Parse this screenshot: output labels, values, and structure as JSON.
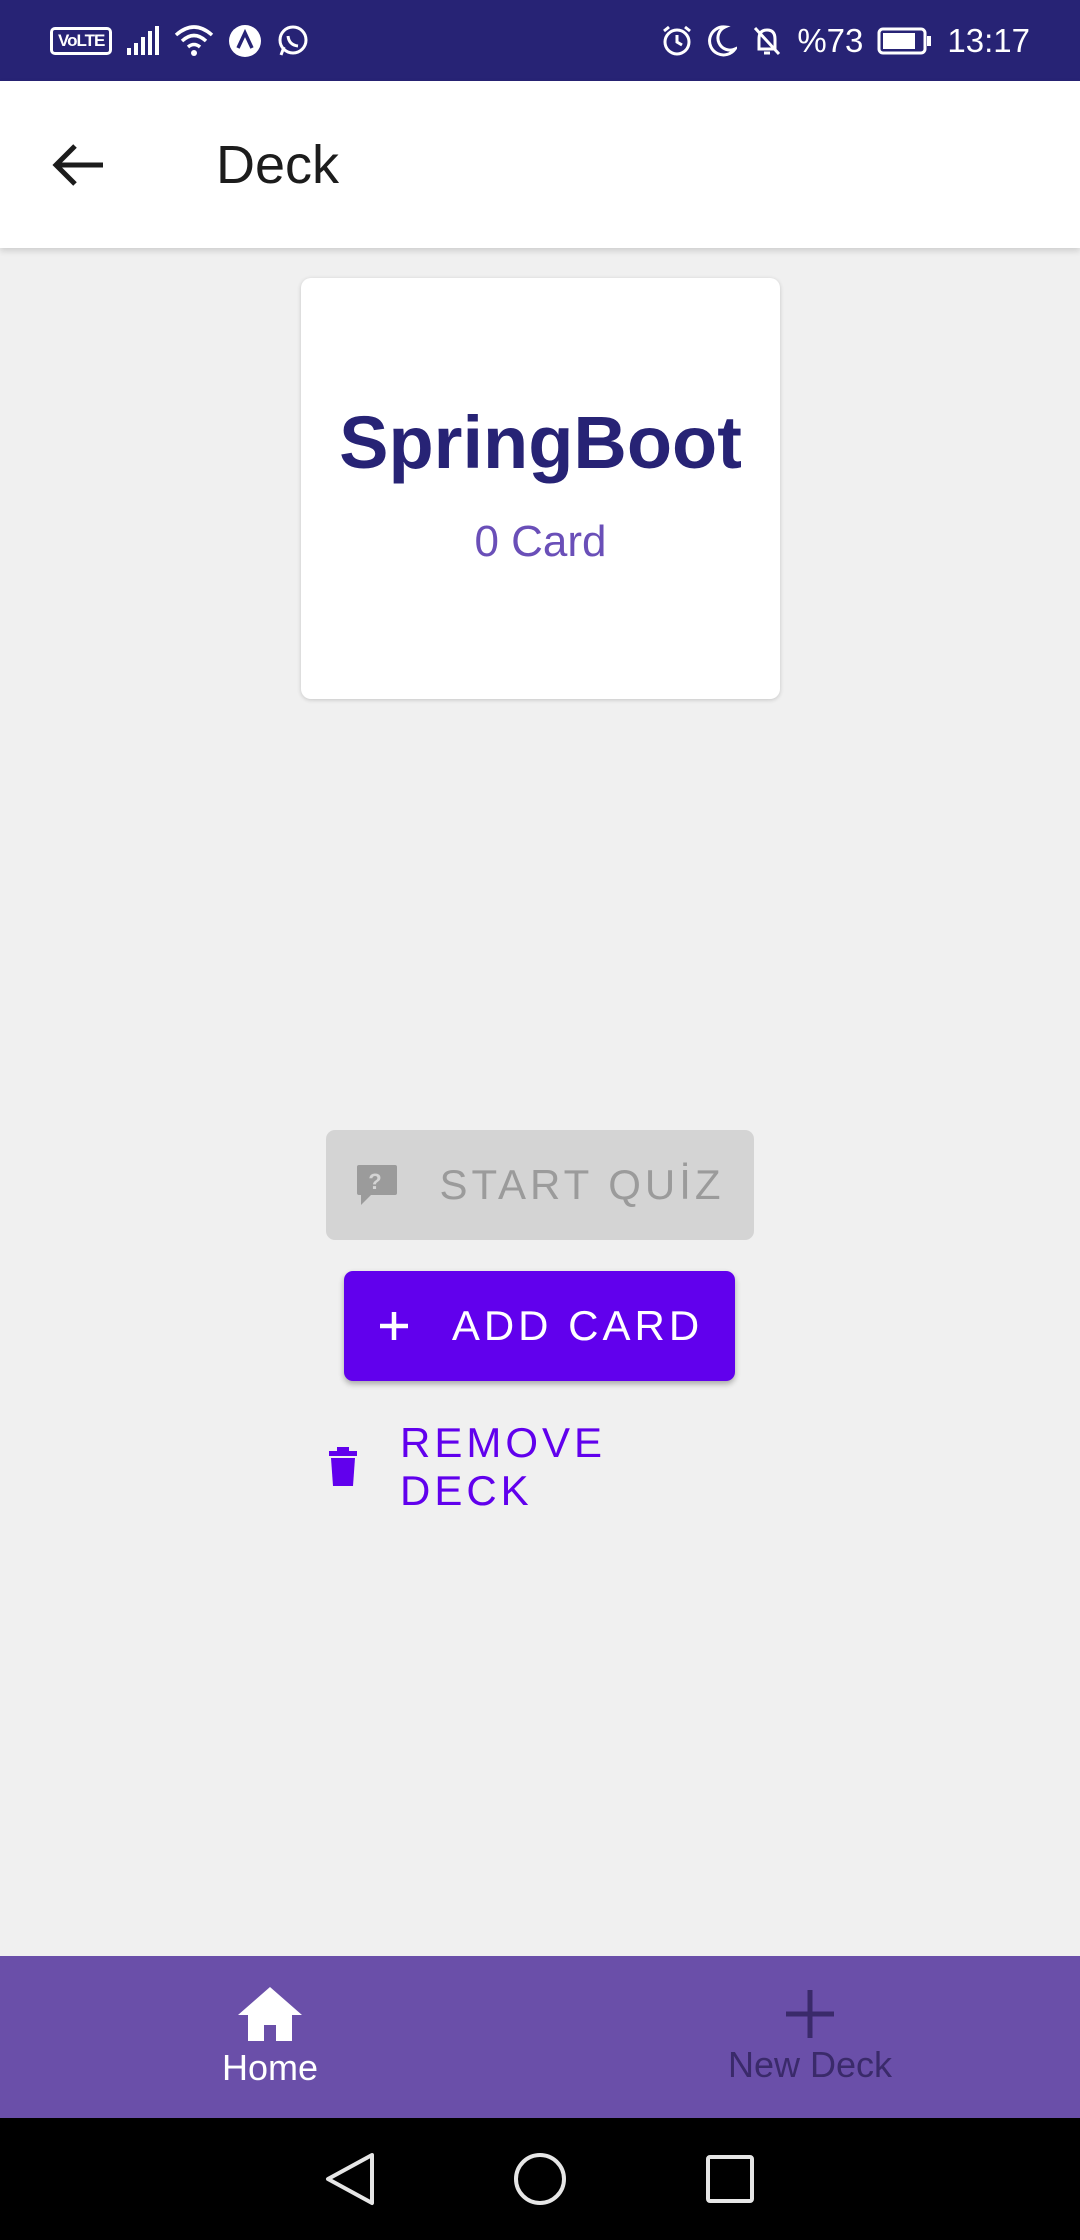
{
  "status_bar": {
    "volte": "VoLTE",
    "battery_text": "%73",
    "time": "13:17"
  },
  "app_bar": {
    "title": "Deck",
    "back_icon": "arrow-back-icon"
  },
  "deck": {
    "name": "SpringBoot",
    "card_count": "0 Card"
  },
  "actions": {
    "start_quiz": {
      "label": "START QUİZ",
      "icon": "quiz-icon",
      "enabled": false
    },
    "add_card": {
      "label": "ADD CARD",
      "icon": "plus-icon"
    },
    "remove_deck": {
      "label": "REMOVE DECK",
      "icon": "trash-icon"
    }
  },
  "bottom_nav": {
    "items": [
      {
        "label": "Home",
        "icon": "home-icon",
        "selected": true
      },
      {
        "label": "New Deck",
        "icon": "plus-icon",
        "selected": false
      }
    ]
  },
  "colors": {
    "status_bar": "#272375",
    "primary": "#6100ed",
    "deck_title": "#272375",
    "nav_bar": "#6a4fa9"
  }
}
